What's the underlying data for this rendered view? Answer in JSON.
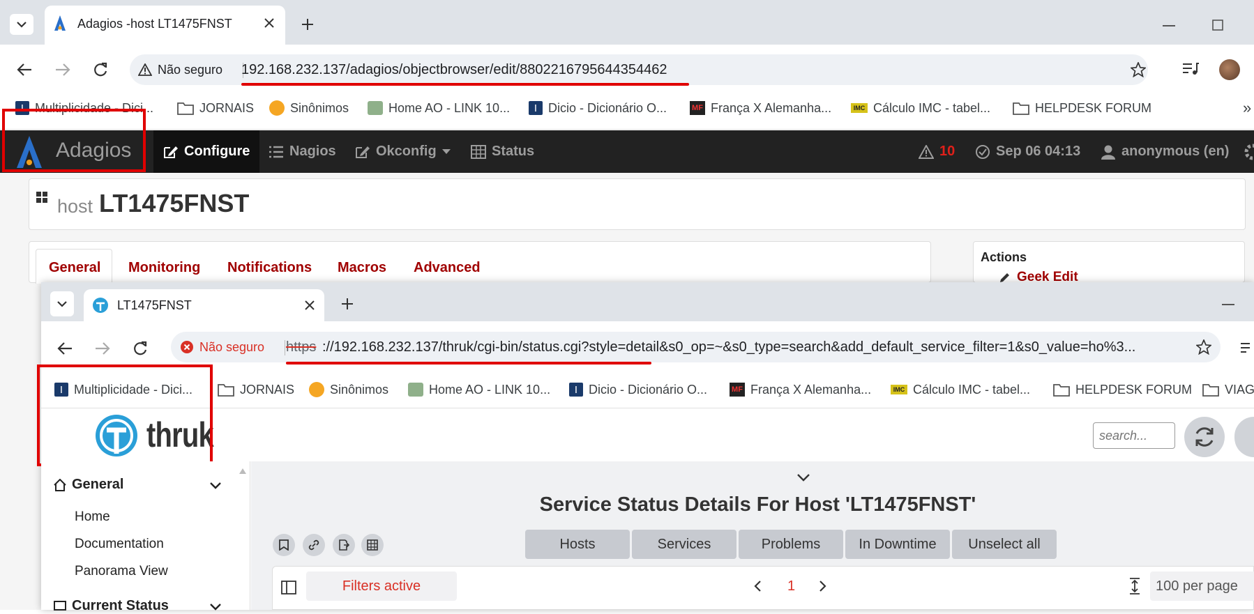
{
  "back_browser": {
    "tab_title": "Adagios -host LT1475FNST",
    "security_label": "Não seguro",
    "url": "192.168.232.137/adagios/objectbrowser/edit/8802216795644354462",
    "bookmarks": [
      "Multiplicidade - Dici...",
      "JORNAIS",
      "Sinônimos",
      "Home AO - LINK 10...",
      "Dicio - Dicionário O...",
      "França X Alemanha...",
      "Cálculo IMC - tabel...",
      "HELPDESK FORUM"
    ],
    "overflow": "»"
  },
  "adagios": {
    "brand": "Adagios",
    "nav": [
      "Configure",
      "Nagios",
      "Okconfig",
      "Status"
    ],
    "alert_count": "10",
    "datetime": "Sep 06 04:13",
    "user": "anonymous (en)",
    "host_prefix": "host",
    "host_name": "LT1475FNST",
    "tabs": [
      "General",
      "Monitoring",
      "Notifications",
      "Macros",
      "Advanced"
    ],
    "actions_title": "Actions",
    "geek_edit": "Geek Edit"
  },
  "front_browser": {
    "tab_title": "LT1475FNST",
    "security_label": "Não seguro",
    "url_scheme": "https",
    "url_rest": "://192.168.232.137/thruk/cgi-bin/status.cgi?style=detail&s0_op=~&s0_type=search&add_default_service_filter=1&s0_value=ho%3...",
    "bookmarks": [
      "Multiplicidade - Dici...",
      "JORNAIS",
      "Sinônimos",
      "Home AO - LINK 10...",
      "Dicio - Dicionário O...",
      "França X Alemanha...",
      "Cálculo IMC - tabel...",
      "HELPDESK FORUM",
      "VIAG"
    ]
  },
  "thruk": {
    "logo_text": "thruk",
    "search_placeholder": "search...",
    "sidebar": {
      "section_general": "General",
      "items": [
        "Home",
        "Documentation",
        "Panorama View"
      ],
      "section_current": "Current Status"
    },
    "page_title": "Service Status Details For Host 'LT1475FNST'",
    "filter_buttons": [
      "Hosts",
      "Services",
      "Problems",
      "In Downtime",
      "Unselect all"
    ],
    "filters_active": "Filters active",
    "page_number": "1",
    "per_page": "100 per page"
  },
  "colors": {
    "annotation_red": "#e00000",
    "adagios_link": "#a00000",
    "navbar": "#222222"
  }
}
